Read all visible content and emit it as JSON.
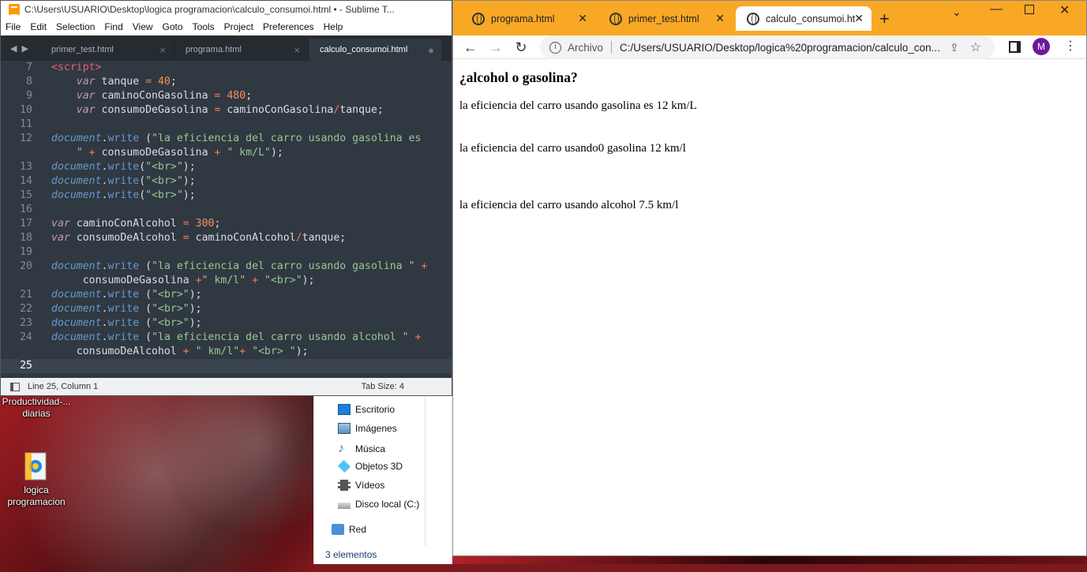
{
  "desktop": {
    "icons": [
      {
        "label": "Productividad-...\ndiarias"
      },
      {
        "label": "logica\nprogramacion"
      }
    ]
  },
  "sublime": {
    "title": "C:\\Users\\USUARIO\\Desktop\\logica programacion\\calculo_consumoi.html • - Sublime T...",
    "menu": [
      "File",
      "Edit",
      "Selection",
      "Find",
      "View",
      "Goto",
      "Tools",
      "Project",
      "Preferences",
      "Help"
    ],
    "tabs": [
      {
        "label": "primer_test.html",
        "close": "×"
      },
      {
        "label": "programa.html",
        "close": "×"
      },
      {
        "label": "calculo_consumoi.html",
        "close": "●"
      }
    ],
    "line_numbers": [
      "7",
      "8",
      "9",
      "10",
      "11",
      "12",
      "",
      "13",
      "14",
      "15",
      "16",
      "17",
      "18",
      "19",
      "20",
      "",
      "21",
      "22",
      "23",
      "24",
      "",
      "25"
    ],
    "status": {
      "position": "Line 25, Column 1",
      "tab_size": "Tab Size: 4"
    }
  },
  "explorer": {
    "items": [
      "Escritorio",
      "Imágenes",
      "Música",
      "Objetos 3D",
      "Vídeos",
      "Disco local (C:)",
      "Red"
    ],
    "count": "3 elementos"
  },
  "chrome": {
    "tabs": [
      {
        "label": "programa.html"
      },
      {
        "label": "primer_test.html"
      },
      {
        "label": "calculo_consumoi.ht"
      }
    ],
    "new_tab": "+",
    "address": {
      "scheme_label": "Archivo",
      "url": "C:/Users/USUARIO/Desktop/logica%20programacion/calculo_con..."
    },
    "profile_initial": "M",
    "page": {
      "heading": "¿alcohol o gasolina?",
      "lines": [
        "la eficiencia del carro usando gasolina es 12 km/L",
        "la eficiencia del carro usando0 gasolina 12 km/l",
        "la eficiencia del carro usando alcohol 7.5 km/l"
      ]
    }
  }
}
